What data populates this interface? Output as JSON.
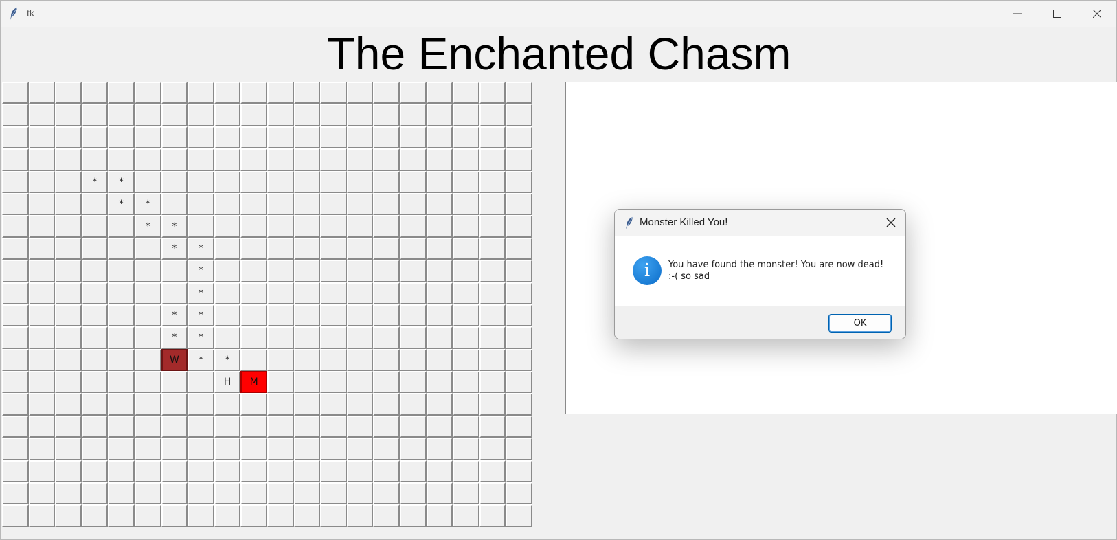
{
  "window": {
    "title": "tk",
    "icon": "feather-icon"
  },
  "heading": "The Enchanted Chasm",
  "grid": {
    "rows": 20,
    "cols": 20,
    "cells": [
      {
        "r": 4,
        "c": 3,
        "text": "*",
        "kind": "path"
      },
      {
        "r": 4,
        "c": 4,
        "text": "*",
        "kind": "path"
      },
      {
        "r": 5,
        "c": 4,
        "text": "*",
        "kind": "path"
      },
      {
        "r": 5,
        "c": 5,
        "text": "*",
        "kind": "path"
      },
      {
        "r": 6,
        "c": 5,
        "text": "*",
        "kind": "path"
      },
      {
        "r": 6,
        "c": 6,
        "text": "*",
        "kind": "path"
      },
      {
        "r": 7,
        "c": 6,
        "text": "*",
        "kind": "path"
      },
      {
        "r": 7,
        "c": 7,
        "text": "*",
        "kind": "path"
      },
      {
        "r": 8,
        "c": 7,
        "text": "*",
        "kind": "path"
      },
      {
        "r": 9,
        "c": 7,
        "text": "*",
        "kind": "path"
      },
      {
        "r": 10,
        "c": 6,
        "text": "*",
        "kind": "path"
      },
      {
        "r": 10,
        "c": 7,
        "text": "*",
        "kind": "path"
      },
      {
        "r": 11,
        "c": 6,
        "text": "*",
        "kind": "path"
      },
      {
        "r": 11,
        "c": 7,
        "text": "*",
        "kind": "path"
      },
      {
        "r": 12,
        "c": 6,
        "text": "W",
        "kind": "wall"
      },
      {
        "r": 12,
        "c": 7,
        "text": "*",
        "kind": "path"
      },
      {
        "r": 12,
        "c": 8,
        "text": "*",
        "kind": "path"
      },
      {
        "r": 13,
        "c": 8,
        "text": "H",
        "kind": "hero"
      },
      {
        "r": 13,
        "c": 9,
        "text": "M",
        "kind": "monster"
      }
    ],
    "colors": {
      "wall": "#a32a2a",
      "monster": "#ff0000"
    }
  },
  "dialog": {
    "title": "Monster Killed You!",
    "icon": "info-icon",
    "message": "You have found the monster! You are now dead!\n :-( so sad",
    "ok_label": "OK"
  }
}
